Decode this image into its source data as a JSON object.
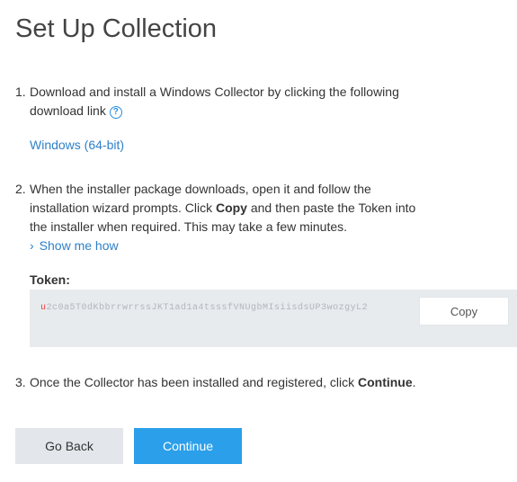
{
  "page": {
    "title": "Set Up Collection"
  },
  "steps": [
    {
      "number": "1.",
      "text": "Download and install a Windows Collector by clicking the following download link",
      "help_icon": "question-circle-icon",
      "link_label": "Windows (64-bit)"
    },
    {
      "number": "2.",
      "text_before": "When the installer package downloads, open it and follow the installation wizard prompts. Click ",
      "bold": "Copy",
      "text_after": " and then paste the Token into the installer when required. This may take a few minutes.",
      "expander_icon": "chevron-right-icon",
      "expander_label": "Show me how"
    },
    {
      "number": "3.",
      "text_before": "Once the Collector has been installed and registered, click ",
      "bold": "Continue",
      "text_after": "."
    }
  ],
  "token": {
    "label": "Token:",
    "value": "u2c0a5T0dKbbrrwrrssJKT1ad1a4tsssfVNUgbMIsiisdsUP3wozgyL2",
    "copy_label": "Copy"
  },
  "buttons": {
    "back_label": "Go Back",
    "continue_label": "Continue"
  },
  "colors": {
    "accent": "#2b9fea",
    "link": "#2f80c8",
    "token_bg": "#e8ebee",
    "secondary_button_bg": "#e3e7eb"
  }
}
